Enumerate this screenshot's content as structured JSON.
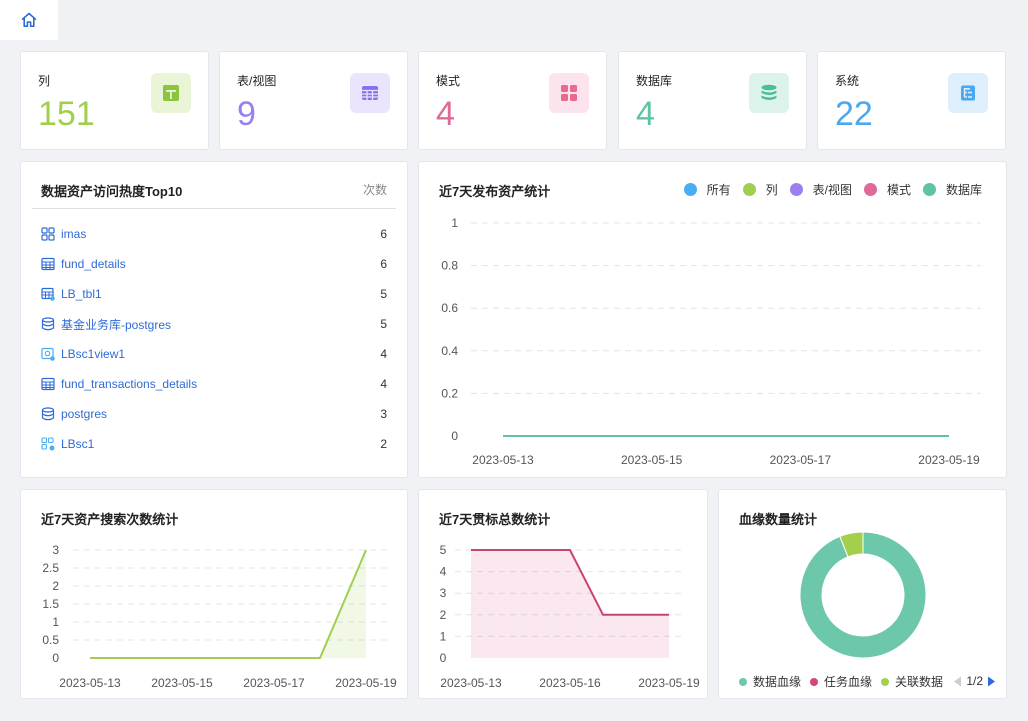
{
  "colors": {
    "columns": "#a0cf4f",
    "tables": "#9b7ff0",
    "schemas": "#e0699a",
    "databases": "#5ec3a6",
    "systems": "#4aa8f0",
    "all": "#4aaef4",
    "link": "#2f6bd6"
  },
  "stats": [
    {
      "label": "列",
      "value": "151",
      "icon": "table-layout-icon"
    },
    {
      "label": "表/视图",
      "value": "9",
      "icon": "grid-table-icon"
    },
    {
      "label": "模式",
      "value": "4",
      "icon": "four-squares-icon"
    },
    {
      "label": "数据库",
      "value": "4",
      "icon": "database-icon"
    },
    {
      "label": "系统",
      "value": "22",
      "icon": "tree-list-icon"
    }
  ],
  "top10": {
    "title": "数据资产访问热度Top10",
    "count_header": "次数",
    "items": [
      {
        "name": "imas",
        "count": "6",
        "icon": "schema-icon"
      },
      {
        "name": "fund_details",
        "count": "6",
        "icon": "table-icon"
      },
      {
        "name": "LB_tbl1",
        "count": "5",
        "icon": "table-link-icon"
      },
      {
        "name": "基金业务库-postgres",
        "count": "5",
        "icon": "database-icon"
      },
      {
        "name": "LBsc1view1",
        "count": "4",
        "icon": "view-icon"
      },
      {
        "name": "fund_transactions_details",
        "count": "4",
        "icon": "table-icon"
      },
      {
        "name": "postgres",
        "count": "3",
        "icon": "database-icon"
      },
      {
        "name": "LBsc1",
        "count": "2",
        "icon": "schema-link-icon"
      }
    ]
  },
  "publish": {
    "title": "近7天发布资产统计",
    "legend": [
      "所有",
      "列",
      "表/视图",
      "模式",
      "数据库"
    ]
  },
  "search": {
    "title": "近7天资产搜索次数统计"
  },
  "standard": {
    "title": "近7天贯标总数统计"
  },
  "lineage": {
    "title": "血缘数量统计",
    "legend": [
      "数据血缘",
      "任务血缘",
      "关联数据"
    ],
    "page": "1/2"
  },
  "chart_data": [
    {
      "type": "line",
      "title": "近7天发布资产统计",
      "x": [
        "2023-05-13",
        "2023-05-14",
        "2023-05-15",
        "2023-05-16",
        "2023-05-17",
        "2023-05-18",
        "2023-05-19"
      ],
      "xticks": [
        "2023-05-13",
        "2023-05-15",
        "2023-05-17",
        "2023-05-19"
      ],
      "ylim": [
        0,
        1
      ],
      "yticks": [
        "0",
        "0.2",
        "0.4",
        "0.6",
        "0.8",
        "1"
      ],
      "series": [
        {
          "name": "所有",
          "values": [
            0,
            0,
            0,
            0,
            0,
            0,
            0
          ]
        },
        {
          "name": "列",
          "values": [
            0,
            0,
            0,
            0,
            0,
            0,
            0
          ]
        },
        {
          "name": "表/视图",
          "values": [
            0,
            0,
            0,
            0,
            0,
            0,
            0
          ]
        },
        {
          "name": "模式",
          "values": [
            0,
            0,
            0,
            0,
            0,
            0,
            0
          ]
        },
        {
          "name": "数据库",
          "values": [
            0,
            0,
            0,
            0,
            0,
            0,
            0
          ]
        }
      ]
    },
    {
      "type": "area",
      "title": "近7天资产搜索次数统计",
      "x": [
        "2023-05-13",
        "2023-05-14",
        "2023-05-15",
        "2023-05-16",
        "2023-05-17",
        "2023-05-18",
        "2023-05-19"
      ],
      "xticks": [
        "2023-05-13",
        "2023-05-15",
        "2023-05-17",
        "2023-05-19"
      ],
      "ylim": [
        0,
        3
      ],
      "yticks": [
        "0",
        "0.5",
        "1",
        "1.5",
        "2",
        "2.5",
        "3"
      ],
      "values": [
        0,
        0,
        0,
        0,
        0,
        0,
        3
      ]
    },
    {
      "type": "area",
      "title": "近7天贯标总数统计",
      "x": [
        "2023-05-13",
        "2023-05-14",
        "2023-05-15",
        "2023-05-16",
        "2023-05-17",
        "2023-05-18",
        "2023-05-19"
      ],
      "xticks": [
        "2023-05-13",
        "2023-05-16",
        "2023-05-19"
      ],
      "ylim": [
        0,
        5
      ],
      "yticks": [
        "0",
        "1",
        "2",
        "3",
        "4",
        "5"
      ],
      "values": [
        5,
        5,
        5,
        5,
        2,
        2,
        2
      ]
    },
    {
      "type": "pie",
      "title": "血缘数量统计",
      "labels": [
        "数据血缘",
        "任务血缘",
        "关联数据"
      ],
      "values": [
        94,
        0,
        6
      ],
      "colors": [
        "#6cc7ab",
        "#d4457a",
        "#a4cf4d"
      ]
    }
  ]
}
